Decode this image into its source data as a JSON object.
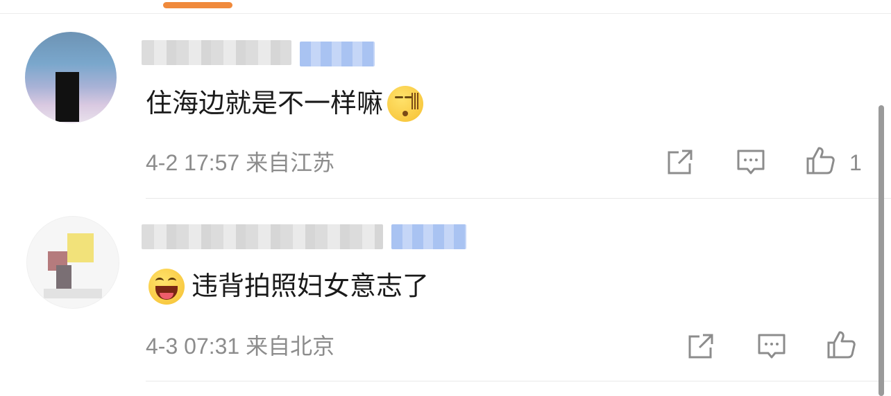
{
  "comments": [
    {
      "text": "住海边就是不一样嘛",
      "emoji": "hum-emoji",
      "meta": "4-2 17:57  来自江苏",
      "like_count": "1"
    },
    {
      "text": "违背拍照妇女意志了",
      "emoji": "laugh-emoji",
      "meta": "4-3 07:31  来自北京",
      "like_count": ""
    }
  ],
  "icons": {
    "share": "share-icon",
    "comment": "comment-icon",
    "like": "thumbs-up-icon"
  },
  "colors": {
    "accent": "#f08a3c",
    "meta_text": "#8c8c8c",
    "body_text": "#1a1a1a"
  }
}
